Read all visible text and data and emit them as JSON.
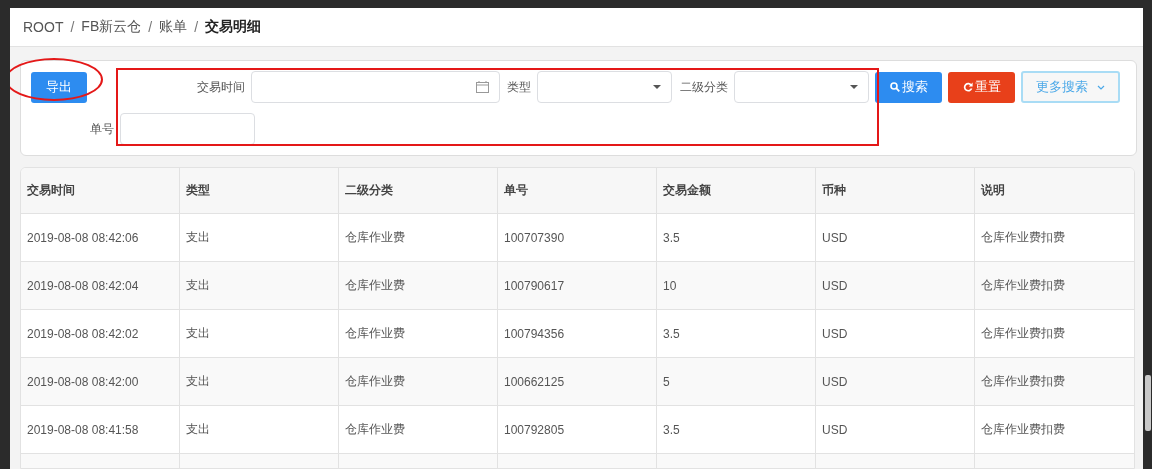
{
  "breadcrumb": [
    {
      "label": "ROOT",
      "current": false
    },
    {
      "label": "FB新云仓",
      "current": false
    },
    {
      "label": "账单",
      "current": false
    },
    {
      "label": "交易明细",
      "current": true
    }
  ],
  "breadcrumb_separator": "/",
  "filters": {
    "export_button": "导出",
    "fields": [
      {
        "label": "交易时间",
        "kind": "date"
      },
      {
        "label": "类型",
        "kind": "select"
      },
      {
        "label": "二级分类",
        "kind": "select"
      },
      {
        "label": "单号",
        "kind": "text"
      }
    ],
    "buttons": [
      {
        "label": "搜索",
        "kind": "search"
      },
      {
        "label": "重置",
        "kind": "reset"
      },
      {
        "label": "更多搜索",
        "kind": "more"
      }
    ]
  },
  "table": {
    "columns": [
      "交易时间",
      "类型",
      "二级分类",
      "单号",
      "交易金额",
      "币种",
      "说明"
    ],
    "rows": [
      [
        "2019-08-08 08:42:06",
        "支出",
        "仓库作业费",
        "100707390",
        "3.5",
        "USD",
        "仓库作业费扣费"
      ],
      [
        "2019-08-08 08:42:04",
        "支出",
        "仓库作业费",
        "100790617",
        "10",
        "USD",
        "仓库作业费扣费"
      ],
      [
        "2019-08-08 08:42:02",
        "支出",
        "仓库作业费",
        "100794356",
        "3.5",
        "USD",
        "仓库作业费扣费"
      ],
      [
        "2019-08-08 08:42:00",
        "支出",
        "仓库作业费",
        "100662125",
        "5",
        "USD",
        "仓库作业费扣费"
      ],
      [
        "2019-08-08 08:41:58",
        "支出",
        "仓库作业费",
        "100792805",
        "3.5",
        "USD",
        "仓库作业费扣费"
      ]
    ]
  },
  "annotations": [
    {
      "kind": "ellipse"
    },
    {
      "kind": "rectangle"
    }
  ]
}
